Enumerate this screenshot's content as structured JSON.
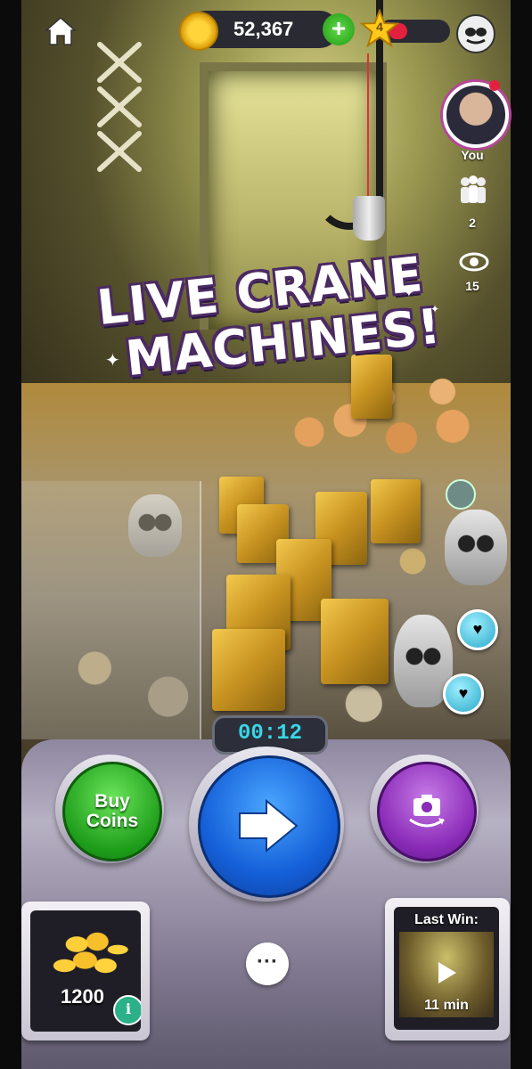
{
  "headline": {
    "line1": "LIVE CRANE",
    "line2": "MACHINES!"
  },
  "top_bar": {
    "coins": "52,367",
    "level": "4",
    "level_progress": 0.3
  },
  "players": {
    "you_label": "You",
    "players_count": "2",
    "viewers_count": "15"
  },
  "timer": "00:12",
  "controls": {
    "buy_line1": "Buy",
    "buy_line2": "Coins"
  },
  "coin_pack": {
    "amount": "1200",
    "info": "i"
  },
  "last_win": {
    "title": "Last Win:",
    "time": "11 min"
  },
  "colors": {
    "coin": "#ffd43b",
    "plus": "#3cc22a",
    "go": "#1a6de6",
    "camera": "#9a3ec7",
    "buy": "#2fb526",
    "timer_text": "#38d6e6"
  }
}
